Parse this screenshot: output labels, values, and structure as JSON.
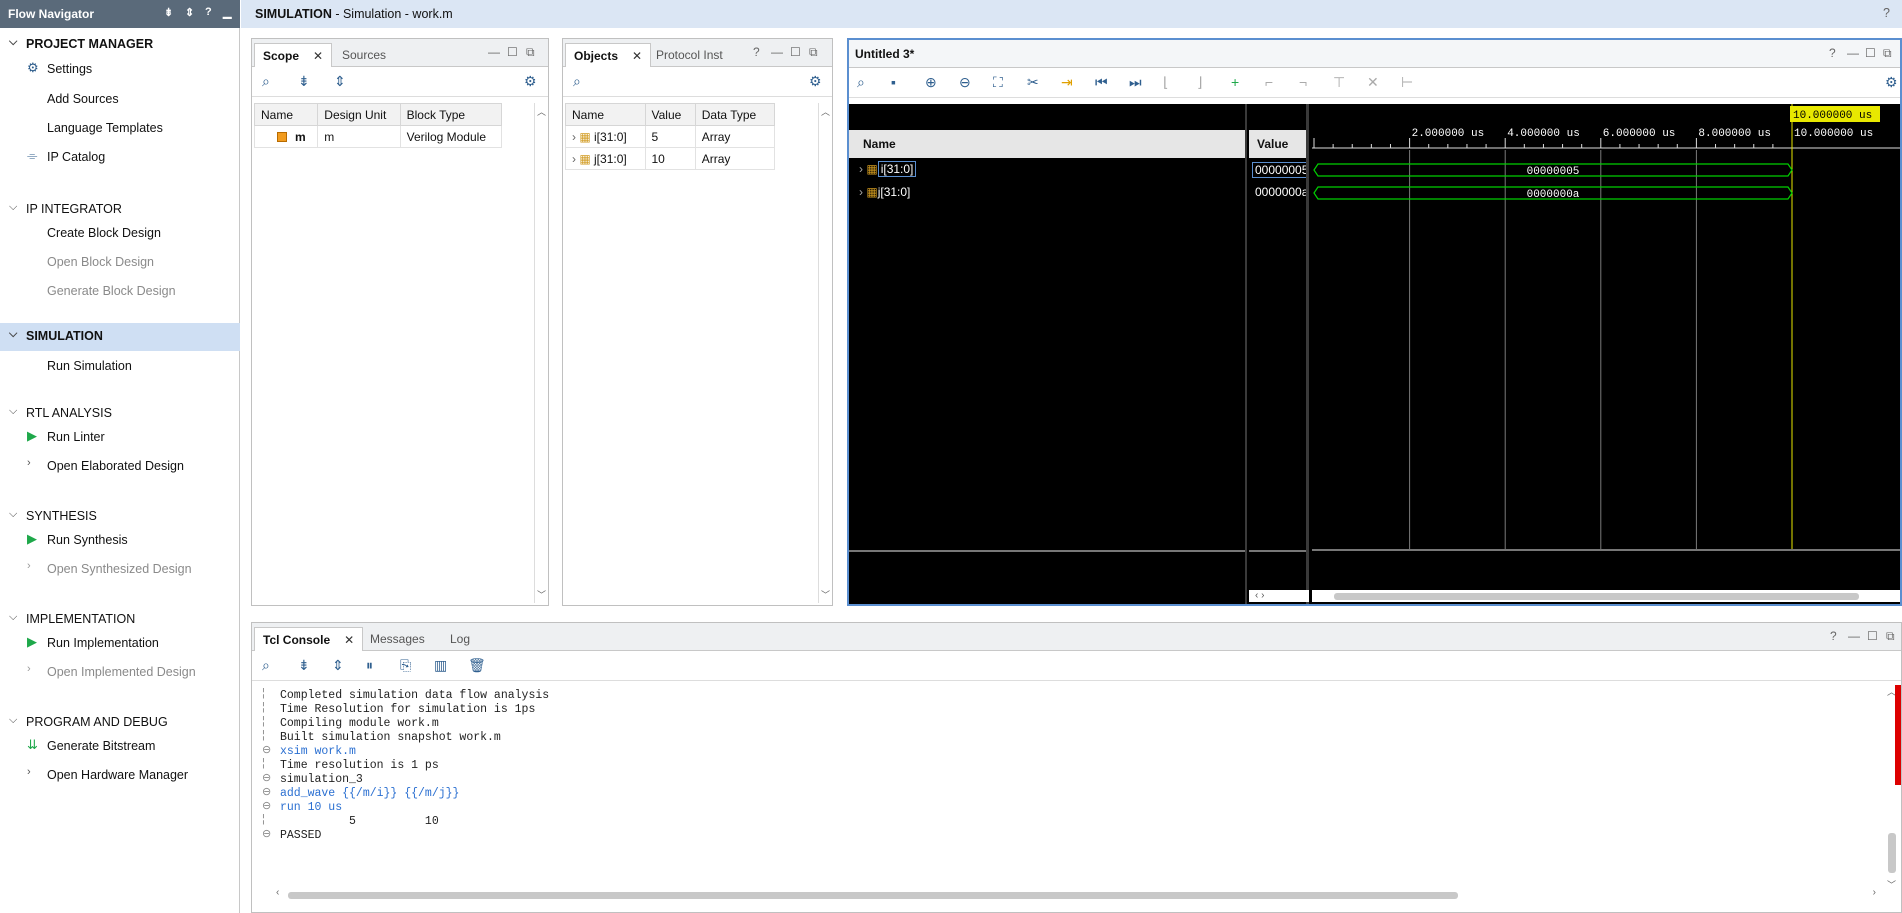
{
  "navigator": {
    "title": "Flow Navigator",
    "sections": {
      "project_manager": {
        "title": "PROJECT MANAGER",
        "items": [
          "Settings",
          "Add Sources",
          "Language Templates",
          "IP Catalog"
        ]
      },
      "ip_integrator": {
        "title": "IP INTEGRATOR",
        "items": [
          "Create Block Design",
          "Open Block Design",
          "Generate Block Design"
        ]
      },
      "simulation": {
        "title": "SIMULATION",
        "items": [
          "Run Simulation"
        ]
      },
      "rtl_analysis": {
        "title": "RTL ANALYSIS",
        "items": [
          "Run Linter",
          "Open Elaborated Design"
        ]
      },
      "synthesis": {
        "title": "SYNTHESIS",
        "items": [
          "Run Synthesis",
          "Open Synthesized Design"
        ]
      },
      "implementation": {
        "title": "IMPLEMENTATION",
        "items": [
          "Run Implementation",
          "Open Implemented Design"
        ]
      },
      "program_debug": {
        "title": "PROGRAM AND DEBUG",
        "items": [
          "Generate Bitstream",
          "Open Hardware Manager"
        ]
      }
    }
  },
  "titlebar": {
    "bold": "SIMULATION",
    "rest": " - Simulation - work.m"
  },
  "scope": {
    "tabs": [
      "Scope",
      "Sources"
    ],
    "columns": [
      "Name",
      "Design Unit",
      "Block Type"
    ],
    "rows": [
      {
        "name": "m",
        "unit": "m",
        "type": "Verilog Module"
      }
    ]
  },
  "objects": {
    "tabs": [
      "Objects",
      "Protocol Inst"
    ],
    "columns": [
      "Name",
      "Value",
      "Data Type"
    ],
    "rows": [
      {
        "name": "i[31:0]",
        "value": "5",
        "type": "Array"
      },
      {
        "name": "j[31:0]",
        "value": "10",
        "type": "Array"
      }
    ]
  },
  "wave": {
    "title": "Untitled 3*",
    "name_header": "Name",
    "value_header": "Value",
    "cursor_label": "10.000000 us",
    "cursor_fraction": 1.0,
    "ticks": [
      "2.000000 us",
      "4.000000 us",
      "6.000000 us",
      "8.000000 us",
      "10.000000 us"
    ],
    "signals": [
      {
        "name": "i[31:0]",
        "value": "00000005",
        "wave": "00000005"
      },
      {
        "name": "j[31:0]",
        "value": "0000000a",
        "wave": "0000000a"
      }
    ],
    "colors": {
      "bg": "#000000",
      "wave": "#00d000",
      "cursor": "#e8e800",
      "grid": "#7a7a7a"
    }
  },
  "console": {
    "tabs": [
      "Tcl Console",
      "Messages",
      "Log"
    ],
    "lines": [
      {
        "t": "Completed simulation data flow analysis",
        "cmd": false
      },
      {
        "t": "Time Resolution for simulation is 1ps",
        "cmd": false
      },
      {
        "t": "Compiling module work.m",
        "cmd": false
      },
      {
        "t": "Built simulation snapshot work.m",
        "cmd": false
      },
      {
        "t": "xsim work.m",
        "cmd": true
      },
      {
        "t": "Time resolution is 1 ps",
        "cmd": false
      },
      {
        "t": "simulation_3",
        "cmd": false
      },
      {
        "t": "add_wave {{/m/i}} {{/m/j}}",
        "cmd": true
      },
      {
        "t": "run 10 us",
        "cmd": true
      },
      {
        "t": "          5          10",
        "cmd": false
      },
      {
        "t": "PASSED",
        "cmd": false
      }
    ]
  }
}
